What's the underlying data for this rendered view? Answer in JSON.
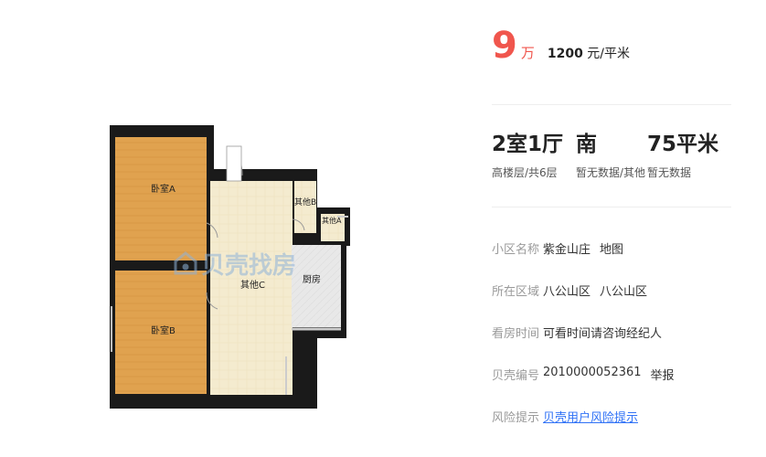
{
  "floorplan": {
    "rooms": {
      "bedroom_a": "卧室A",
      "bedroom_b": "卧室B",
      "other_c": "其他C",
      "other_b": "其他B",
      "other_a": "其他A",
      "kitchen": "厨房"
    }
  },
  "watermark": {
    "text": "贝壳找房"
  },
  "price": {
    "total": "9",
    "total_unit": "万",
    "unit_price_value": "1200",
    "unit_price_unit": "元/平米"
  },
  "stats": [
    {
      "main": "2室1厅",
      "sub": "高楼层/共6层"
    },
    {
      "main": "南",
      "sub": "暂无数据/其他"
    },
    {
      "main": "75平米",
      "sub": "暂无数据"
    }
  ],
  "info": {
    "community": {
      "label": "小区名称",
      "value": "紫金山庄",
      "extra": "地图"
    },
    "area": {
      "label": "所在区域",
      "value": "八公山区",
      "extra": "八公山区"
    },
    "visit": {
      "label": "看房时间",
      "value": "可看时间请咨询经纪人"
    },
    "listing_id": {
      "label": "贝壳编号",
      "value": "2010000052361",
      "extra": "举报"
    },
    "risk": {
      "label": "风险提示",
      "value": "贝壳用户风险提示"
    }
  },
  "colors": {
    "price": "#f0564d",
    "link": "#3072f6",
    "wall": "#1a1a1a",
    "floor_wood": "#e0a24f",
    "floor_tile": "#f2e8cc"
  }
}
